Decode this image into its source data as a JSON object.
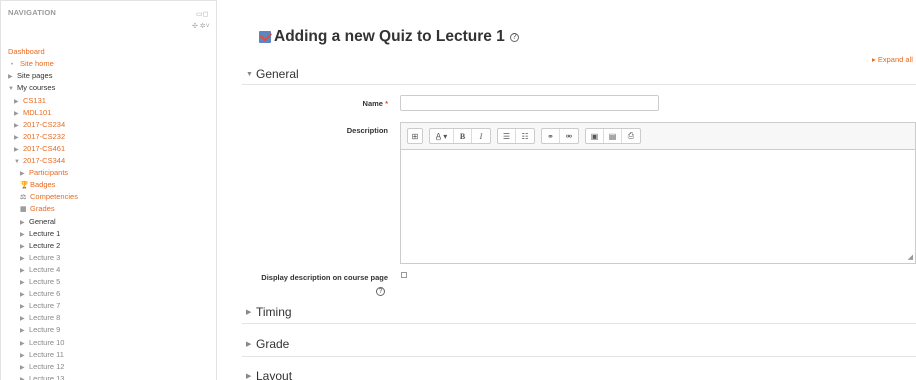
{
  "nav": {
    "title": "NAVIGATION",
    "dock_icons": "▭◻",
    "move_icons": "✣ ✲˅",
    "items": [
      {
        "label": "Dashboard",
        "style": "link",
        "marker": "none"
      },
      {
        "label": "Site home",
        "style": "link",
        "marker": "bullet"
      },
      {
        "label": "Site pages",
        "style": "plain",
        "marker": "arrow-right"
      },
      {
        "label": "My courses",
        "style": "plain",
        "marker": "arrow-down"
      },
      {
        "label": "CS131",
        "style": "link",
        "marker": "arrow-right"
      },
      {
        "label": "MDL101",
        "style": "link",
        "marker": "arrow-right"
      },
      {
        "label": "2017-CS234",
        "style": "link",
        "marker": "arrow-right"
      },
      {
        "label": "2017-CS232",
        "style": "link",
        "marker": "arrow-right"
      },
      {
        "label": "2017-CS461",
        "style": "link",
        "marker": "arrow-right"
      },
      {
        "label": "2017-CS344",
        "style": "link",
        "marker": "arrow-down"
      },
      {
        "label": "Participants",
        "style": "link",
        "marker": "arrow-right"
      },
      {
        "label": "Badges",
        "style": "link",
        "marker": "trophy-icon"
      },
      {
        "label": "Competencies",
        "style": "link",
        "marker": "competency-icon"
      },
      {
        "label": "Grades",
        "style": "link",
        "marker": "grades-icon"
      },
      {
        "label": "General",
        "style": "plain",
        "marker": "arrow-right"
      },
      {
        "label": "Lecture 1",
        "style": "plain",
        "marker": "arrow-right"
      },
      {
        "label": "Lecture 2",
        "style": "plain",
        "marker": "arrow-right"
      },
      {
        "label": "Lecture 3",
        "style": "grey",
        "marker": "arrow-right"
      },
      {
        "label": "Lecture 4",
        "style": "grey",
        "marker": "arrow-right"
      },
      {
        "label": "Lecture 5",
        "style": "grey",
        "marker": "arrow-right"
      },
      {
        "label": "Lecture 6",
        "style": "grey",
        "marker": "arrow-right"
      },
      {
        "label": "Lecture 7",
        "style": "grey",
        "marker": "arrow-right"
      },
      {
        "label": "Lecture 8",
        "style": "grey",
        "marker": "arrow-right"
      },
      {
        "label": "Lecture 9",
        "style": "grey",
        "marker": "arrow-right"
      },
      {
        "label": "Lecture 10",
        "style": "grey",
        "marker": "arrow-right"
      },
      {
        "label": "Lecture 11",
        "style": "grey",
        "marker": "arrow-right"
      },
      {
        "label": "Lecture 12",
        "style": "grey",
        "marker": "arrow-right"
      },
      {
        "label": "Lecture 13",
        "style": "grey",
        "marker": "arrow-right"
      }
    ]
  },
  "page": {
    "heading": "Adding a new Quiz to Lecture 1",
    "help_glyph": "?",
    "expand_all": "▸ Expand all"
  },
  "sections": {
    "general": {
      "label": "General",
      "expanded": true
    },
    "timing": {
      "label": "Timing",
      "expanded": false
    },
    "grade": {
      "label": "Grade",
      "expanded": false
    },
    "layout": {
      "label": "Layout",
      "expanded": false
    }
  },
  "form": {
    "name_label": "Name",
    "required_mark": "*",
    "name_value": "",
    "description_label": "Description",
    "description_value": "",
    "display_label": "Display description on course page",
    "display_checked": false,
    "help_glyph": "?"
  },
  "toolbar": {
    "groups": [
      [
        "⊞"
      ],
      [
        "A̲ ▾",
        "B",
        "I"
      ],
      [
        "☰",
        "☷"
      ],
      [
        "⚭",
        "⚮"
      ],
      [
        "▣",
        "▤",
        "⎙"
      ]
    ]
  },
  "colors": {
    "link": "#ea6a1f",
    "required": "#e04c1e"
  }
}
